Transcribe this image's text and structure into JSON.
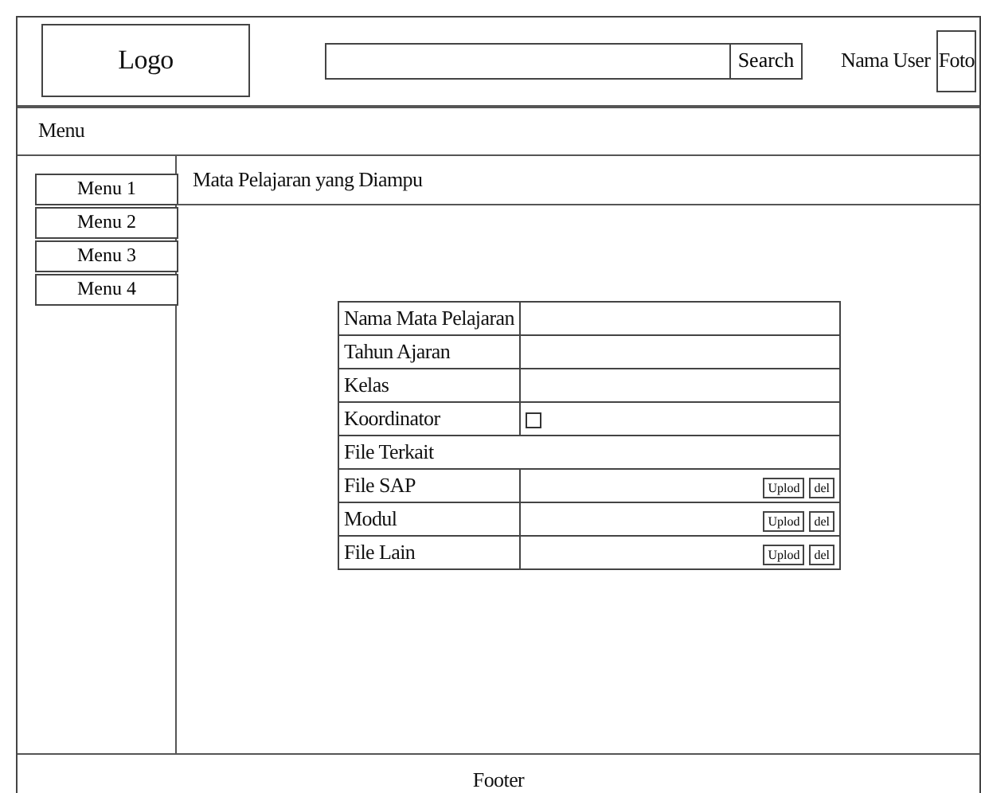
{
  "header": {
    "logo": "Logo",
    "search": {
      "button": "Search"
    },
    "user_name": "Nama User",
    "photo": "Foto"
  },
  "menu_bar": {
    "label": "Menu"
  },
  "sidebar": {
    "items": [
      {
        "label": "Menu 1"
      },
      {
        "label": "Menu 2"
      },
      {
        "label": "Menu 3"
      },
      {
        "label": "Menu 4"
      }
    ]
  },
  "content": {
    "title": "Mata Pelajaran yang Diampu",
    "form": [
      {
        "kind": "field",
        "label": "Nama Mata Pelajaran"
      },
      {
        "kind": "field",
        "label": "Tahun Ajaran"
      },
      {
        "kind": "field",
        "label": "Kelas"
      },
      {
        "kind": "checkbox",
        "label": "Koordinator",
        "checked": false
      },
      {
        "kind": "section",
        "label": "File Terkait"
      },
      {
        "kind": "file",
        "label": "File SAP",
        "upload": "Uplod",
        "delete": "del"
      },
      {
        "kind": "file",
        "label": "Modul",
        "upload": "Uplod",
        "delete": "del"
      },
      {
        "kind": "file",
        "label": "File Lain",
        "upload": "Uplod",
        "delete": "del"
      }
    ]
  },
  "footer": {
    "label": "Footer"
  }
}
